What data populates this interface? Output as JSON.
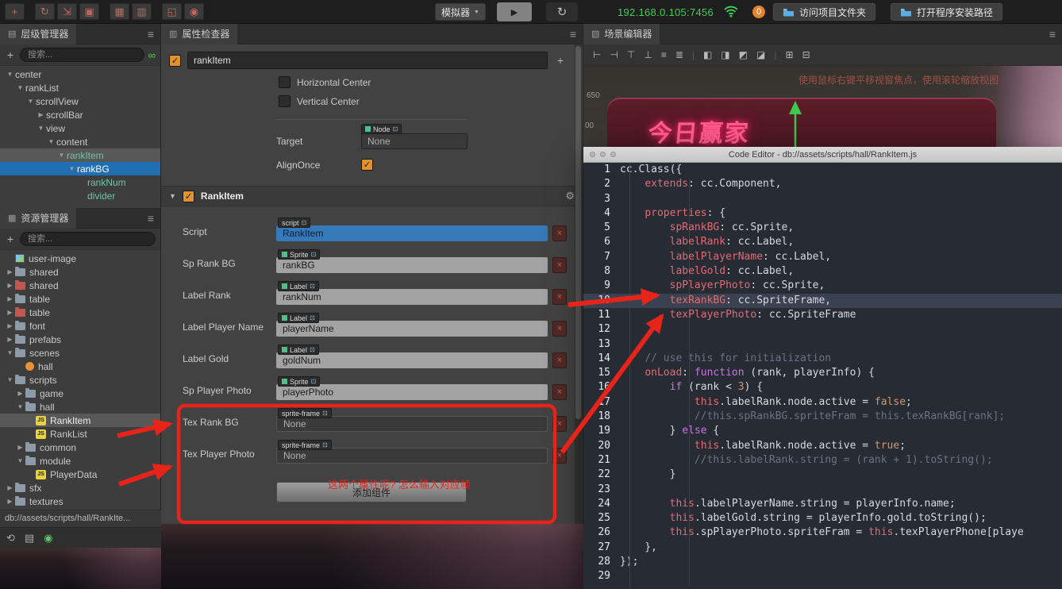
{
  "topbar": {
    "tools": [
      {
        "name": "move-tool-icon",
        "glyph": "+"
      },
      {
        "name": "rotate-tool-icon",
        "glyph": "↻",
        "gap": true
      },
      {
        "name": "scale-tool-icon",
        "glyph": "⇲"
      },
      {
        "name": "rect-tool-icon",
        "glyph": "▣"
      },
      {
        "name": "grid-tool-icon",
        "glyph": "▦",
        "gap": true
      },
      {
        "name": "mask-tool-icon",
        "glyph": "▥"
      },
      {
        "name": "canvas-tool-icon",
        "glyph": "◱",
        "gap": true
      },
      {
        "name": "gizmo-tool-icon",
        "glyph": "◉"
      }
    ],
    "simulator_label": "模拟器",
    "play_glyph": "▶",
    "refresh_glyph": "↻",
    "ip": "192.168.0.105:7456",
    "badge": "0",
    "btn_open_folder": "访问项目文件夹",
    "btn_open_install": "打开程序安装路径"
  },
  "hierarchy": {
    "title": "层级管理器",
    "search_placeholder": "搜索...",
    "nodes": [
      {
        "label": "center",
        "depth": 0,
        "arrow": "down"
      },
      {
        "label": "rankList",
        "depth": 1,
        "arrow": "down"
      },
      {
        "label": "scrollView",
        "depth": 2,
        "arrow": "down"
      },
      {
        "label": "scrollBar",
        "depth": 3,
        "arrow": "right"
      },
      {
        "label": "view",
        "depth": 3,
        "arrow": "down"
      },
      {
        "label": "content",
        "depth": 4,
        "arrow": "down"
      },
      {
        "label": "rankItem",
        "depth": 5,
        "arrow": "down",
        "state": "active",
        "prefab": true
      },
      {
        "label": "rankBG",
        "depth": 6,
        "arrow": "down",
        "state": "selected",
        "prefab": true
      },
      {
        "label": "rankNum",
        "depth": 7,
        "arrow": "none",
        "prefab": true
      },
      {
        "label": "divider",
        "depth": 7,
        "arrow": "none",
        "prefab": true
      }
    ]
  },
  "assets": {
    "title": "资源管理器",
    "search_placeholder": "搜索...",
    "items": [
      {
        "label": "user-image",
        "depth": 0,
        "arrow": "none",
        "icon": "image"
      },
      {
        "label": "shared",
        "depth": 0,
        "arrow": "right",
        "icon": "folder"
      },
      {
        "label": "shared",
        "depth": 0,
        "arrow": "right",
        "icon": "folder-red"
      },
      {
        "label": "table",
        "depth": 0,
        "arrow": "right",
        "icon": "folder"
      },
      {
        "label": "table",
        "depth": 0,
        "arrow": "right",
        "icon": "folder-red"
      },
      {
        "label": "font",
        "depth": 0,
        "arrow": "right",
        "icon": "folder"
      },
      {
        "label": "prefabs",
        "depth": 0,
        "arrow": "right",
        "icon": "folder"
      },
      {
        "label": "scenes",
        "depth": 0,
        "arrow": "down",
        "icon": "folder"
      },
      {
        "label": "hall",
        "depth": 1,
        "arrow": "none",
        "icon": "scene"
      },
      {
        "label": "scripts",
        "depth": 0,
        "arrow": "down",
        "icon": "folder"
      },
      {
        "label": "game",
        "depth": 1,
        "arrow": "right",
        "icon": "folder"
      },
      {
        "label": "hall",
        "depth": 1,
        "arrow": "down",
        "icon": "folder"
      },
      {
        "label": "RankItem",
        "depth": 2,
        "arrow": "none",
        "icon": "js",
        "state": "active"
      },
      {
        "label": "RankList",
        "depth": 2,
        "arrow": "none",
        "icon": "js"
      },
      {
        "label": "common",
        "depth": 1,
        "arrow": "right",
        "icon": "folder"
      },
      {
        "label": "module",
        "depth": 1,
        "arrow": "down",
        "icon": "folder"
      },
      {
        "label": "PlayerData",
        "depth": 2,
        "arrow": "none",
        "icon": "js"
      },
      {
        "label": "sfx",
        "depth": 0,
        "arrow": "right",
        "icon": "folder"
      },
      {
        "label": "textures",
        "depth": 0,
        "arrow": "right",
        "icon": "folder"
      }
    ],
    "status": "db://assets/scripts/hall/RankIte..."
  },
  "inspector": {
    "title": "属性检查器",
    "node_name": "rankItem",
    "widget": {
      "h_center": "Horizontal Center",
      "v_center": "Vertical Center",
      "target_label": "Target",
      "target_type": "Node",
      "target_value": "None",
      "align_once": "AlignOnce"
    },
    "component": {
      "name": "RankItem",
      "props": [
        {
          "label": "Script",
          "chip": "script",
          "value": "RankItem",
          "style": "script"
        },
        {
          "label": "Sp Rank BG",
          "chip": "Sprite",
          "value": "rankBG",
          "style": "ref"
        },
        {
          "label": "Label Rank",
          "chip": "Label",
          "value": "rankNum",
          "style": "ref"
        },
        {
          "label": "Label Player Name",
          "chip": "Label",
          "value": "playerName",
          "style": "ref"
        },
        {
          "label": "Label Gold",
          "chip": "Label",
          "value": "goldNum",
          "style": "ref"
        },
        {
          "label": "Sp Player Photo",
          "chip": "Sprite",
          "value": "playerPhoto",
          "style": "ref"
        },
        {
          "label": "Tex Rank BG",
          "chip": "sprite-frame",
          "value": "None",
          "style": "none"
        },
        {
          "label": "Tex Player Photo",
          "chip": "sprite-frame",
          "value": "None",
          "style": "none"
        }
      ],
      "add_component": "添加组件"
    }
  },
  "scene": {
    "title": "场景编辑器",
    "toolbar": [
      {
        "name": "align-left-icon",
        "glyph": "⊢"
      },
      {
        "name": "align-right-icon",
        "glyph": "⊣"
      },
      {
        "name": "align-top-icon",
        "glyph": "⊤"
      },
      {
        "name": "align-bottom-icon",
        "glyph": "⊥"
      },
      {
        "name": "align-center-h-icon",
        "glyph": "≡"
      },
      {
        "name": "align-center-v-icon",
        "glyph": "≣"
      },
      {
        "name": "separator",
        "glyph": "|"
      },
      {
        "name": "distribute-left-icon",
        "glyph": "◧"
      },
      {
        "name": "distribute-right-icon",
        "glyph": "◨"
      },
      {
        "name": "distribute-top-icon",
        "glyph": "◩"
      },
      {
        "name": "distribute-bottom-icon",
        "glyph": "◪"
      },
      {
        "name": "separator",
        "glyph": "|"
      },
      {
        "name": "snap-grid-icon",
        "glyph": "⊞"
      },
      {
        "name": "show-grid-icon",
        "glyph": "⊟"
      }
    ],
    "hint": "使用鼠标右键平移视窗焦点，使用滚轮缩放视图",
    "banner_text": "今日赢家",
    "ruler_labels": [
      "650",
      "00"
    ]
  },
  "code_editor": {
    "title": "Code Editor - db://assets/scripts/hall/RankItem.js",
    "highlight_line": 10,
    "lines": [
      "cc.Class({",
      "    extends: cc.Component,",
      "",
      "    properties: {",
      "        spRankBG: cc.Sprite,",
      "        labelRank: cc.Label,",
      "        labelPlayerName: cc.Label,",
      "        labelGold: cc.Label,",
      "        spPlayerPhoto: cc.Sprite,",
      "        texRankBG: cc.SpriteFrame,",
      "        texPlayerPhoto: cc.SpriteFrame",
      "",
      "",
      "    // use this for initialization",
      "    onLoad: function (rank, playerInfo) {",
      "        if (rank < 3) {",
      "            this.labelRank.node.active = false;",
      "            //this.spRankBG.spriteFram = this.texRankBG[rank];",
      "        } else {",
      "            this.labelRank.node.active = true;",
      "            //this.labelRank.string = (rank + 1).toString();",
      "        }",
      "",
      "        this.labelPlayerName.string = playerInfo.name;",
      "        this.labelGold.string = playerInfo.gold.toString();",
      "        this.spPlayerPhoto.spriteFram = this.texPlayerPhone[playe",
      "    },",
      "});",
      ""
    ]
  },
  "annotation": {
    "note": "这两个属性呢? 怎么输入对应帧"
  }
}
